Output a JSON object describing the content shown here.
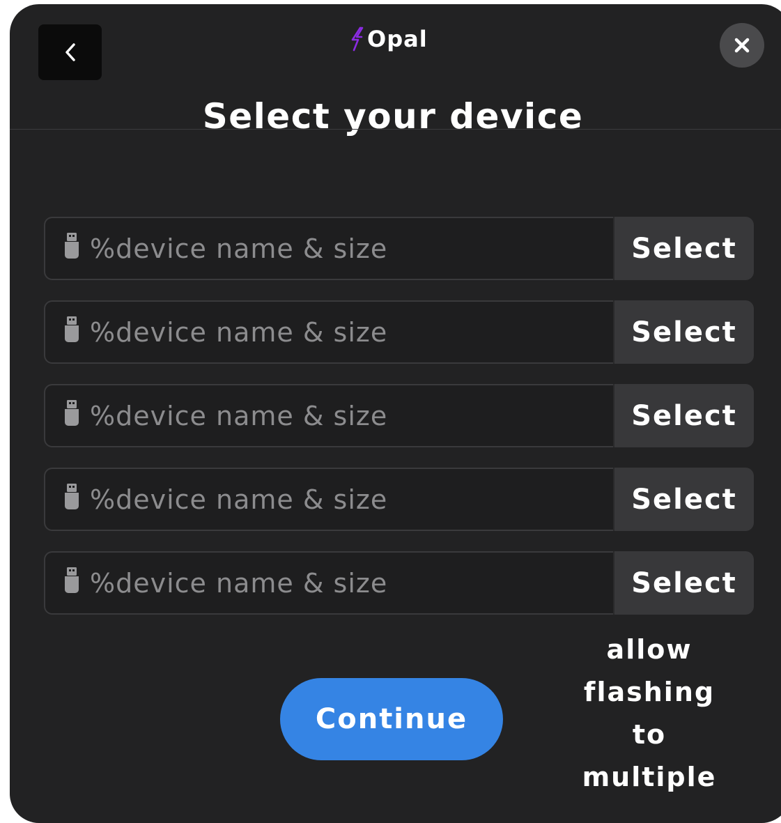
{
  "header": {
    "brand_name": "Opal",
    "title": "Select your device"
  },
  "devices": [
    {
      "label": "%device name & size",
      "select_label": "Select"
    },
    {
      "label": "%device name & size",
      "select_label": "Select"
    },
    {
      "label": "%device name & size",
      "select_label": "Select"
    },
    {
      "label": "%device name & size",
      "select_label": "Select"
    },
    {
      "label": "%device name & size",
      "select_label": "Select"
    }
  ],
  "footer": {
    "continue_label": "Continue",
    "note": "allow flashing to multiple"
  },
  "icons": {
    "back": "chevron-left-icon",
    "close": "close-icon",
    "brand": "lightning-bolt-icon",
    "device": "usb-drive-icon"
  },
  "colors": {
    "background": "#222223",
    "accent": "#3584e4",
    "brand_bolt": "#8a2be2",
    "select_button": "#38383a",
    "close_button": "#4a4a4c"
  }
}
